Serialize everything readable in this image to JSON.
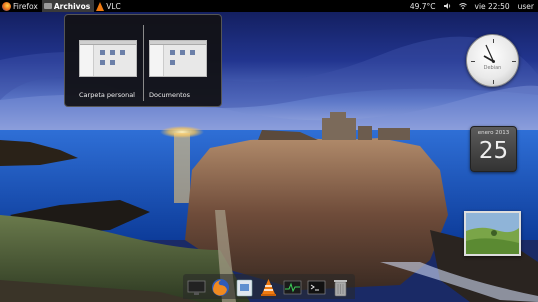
{
  "topbar": {
    "apps": [
      {
        "label": "Firefox",
        "active": false
      },
      {
        "label": "Archivos",
        "active": true
      },
      {
        "label": "VLC",
        "active": false
      }
    ],
    "temperature": "49.7°C",
    "datetime": "vie 22:50",
    "user": "user"
  },
  "workspace_popup": {
    "items": [
      {
        "label": "Carpeta personal"
      },
      {
        "label": "Documentos"
      }
    ]
  },
  "desklets": {
    "clock_brand": "Debian",
    "calendar_month": "enero 2013",
    "calendar_day": "25"
  },
  "dock": {
    "items": [
      "monitor",
      "firefox",
      "file-manager",
      "vlc",
      "system-monitor",
      "terminal",
      "trash"
    ]
  },
  "colors": {
    "sky": "#1b2e78",
    "sea": "#2c6bd0",
    "sunset": "#ffcf70"
  }
}
